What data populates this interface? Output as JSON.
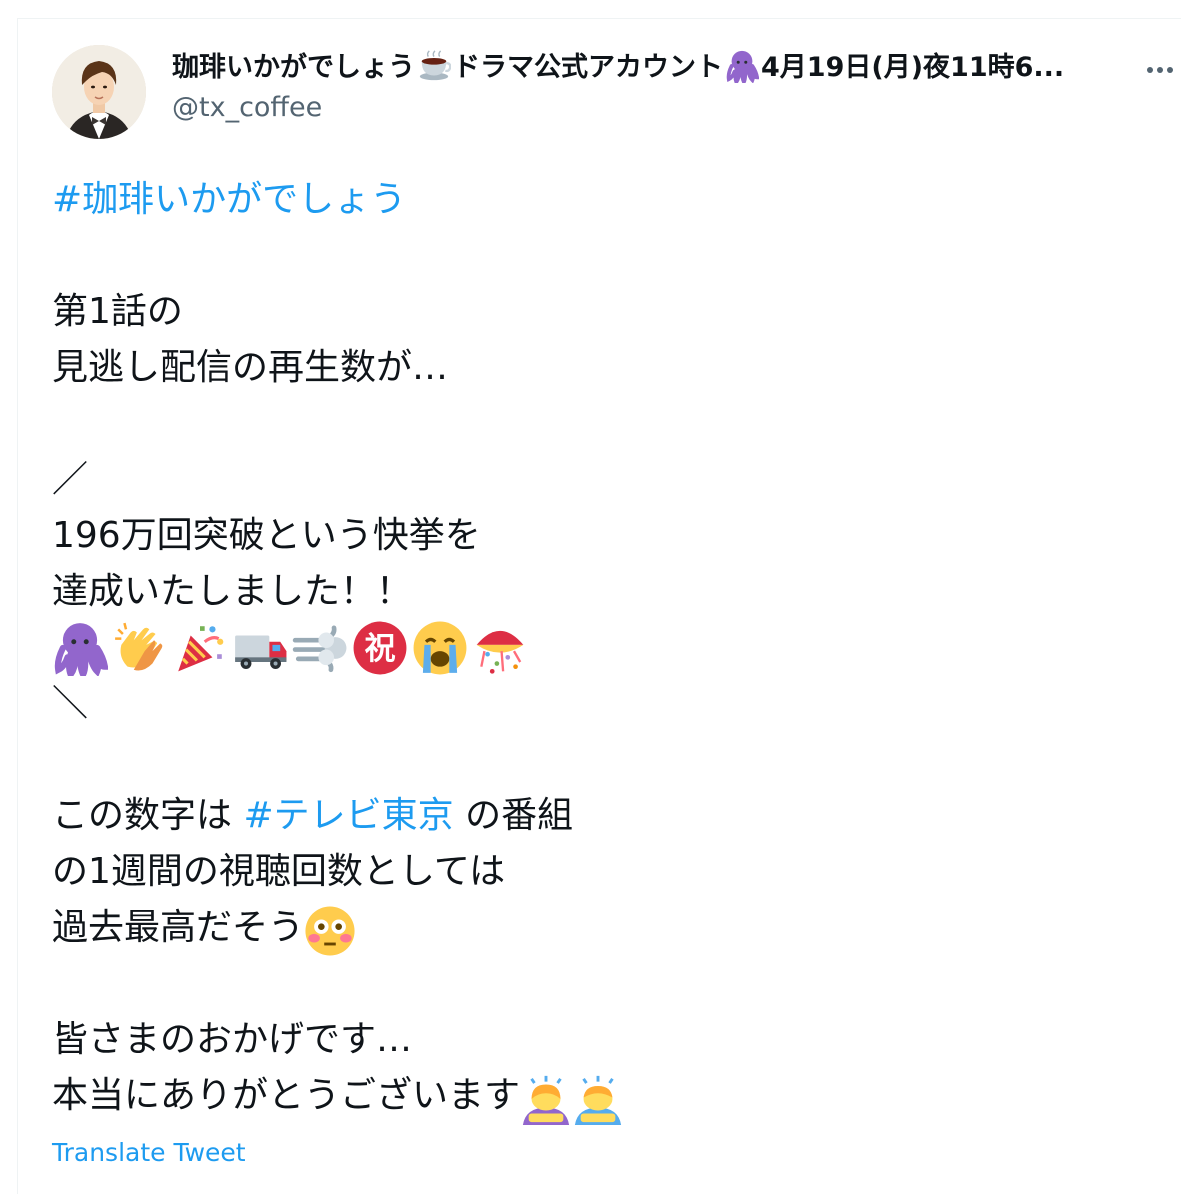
{
  "tweet": {
    "author": {
      "display_name_part1": "珈琲いかがでしょう",
      "display_name_part2": "ドラマ公式アカウント",
      "display_name_part3": "4月19日(月)夜11時6...",
      "handle": "@tx_coffee",
      "name_icons": [
        "coffee-icon",
        "octopus-icon"
      ]
    },
    "more_label": "More",
    "body": {
      "hashtag1": "#珈琲いかがでしょう",
      "line1": "第1話の",
      "line2": "見逃し配信の再生数が…",
      "slash_open": "／",
      "line3": "196万回突破という快挙を",
      "line4": "達成いたしました！！",
      "emoji_row": [
        "octopus-icon",
        "clapping-hands-icon",
        "party-popper-icon",
        "truck-icon",
        "dash-icon",
        "congratulations-icon",
        "crying-face-icon",
        "confetti-ball-icon"
      ],
      "slash_close": "＼",
      "line5_prefix": "この数字は ",
      "hashtag2": "#テレビ東京",
      "line5_suffix": " の番組",
      "line6": "の1週間の視聴回数としては",
      "line7": "過去最高だそう",
      "line7_emoji": "flushed-face-icon",
      "line8": "皆さまのおかげです…",
      "line9": "本当にありがとうございます",
      "line9_emojis": [
        "woman-bowing-icon",
        "man-bowing-icon"
      ]
    },
    "translate_label": "Translate Tweet"
  },
  "colors": {
    "link": "#1d9bf0",
    "secondary_text": "#536471",
    "text": "#0f1419",
    "border": "#eff3f4"
  }
}
